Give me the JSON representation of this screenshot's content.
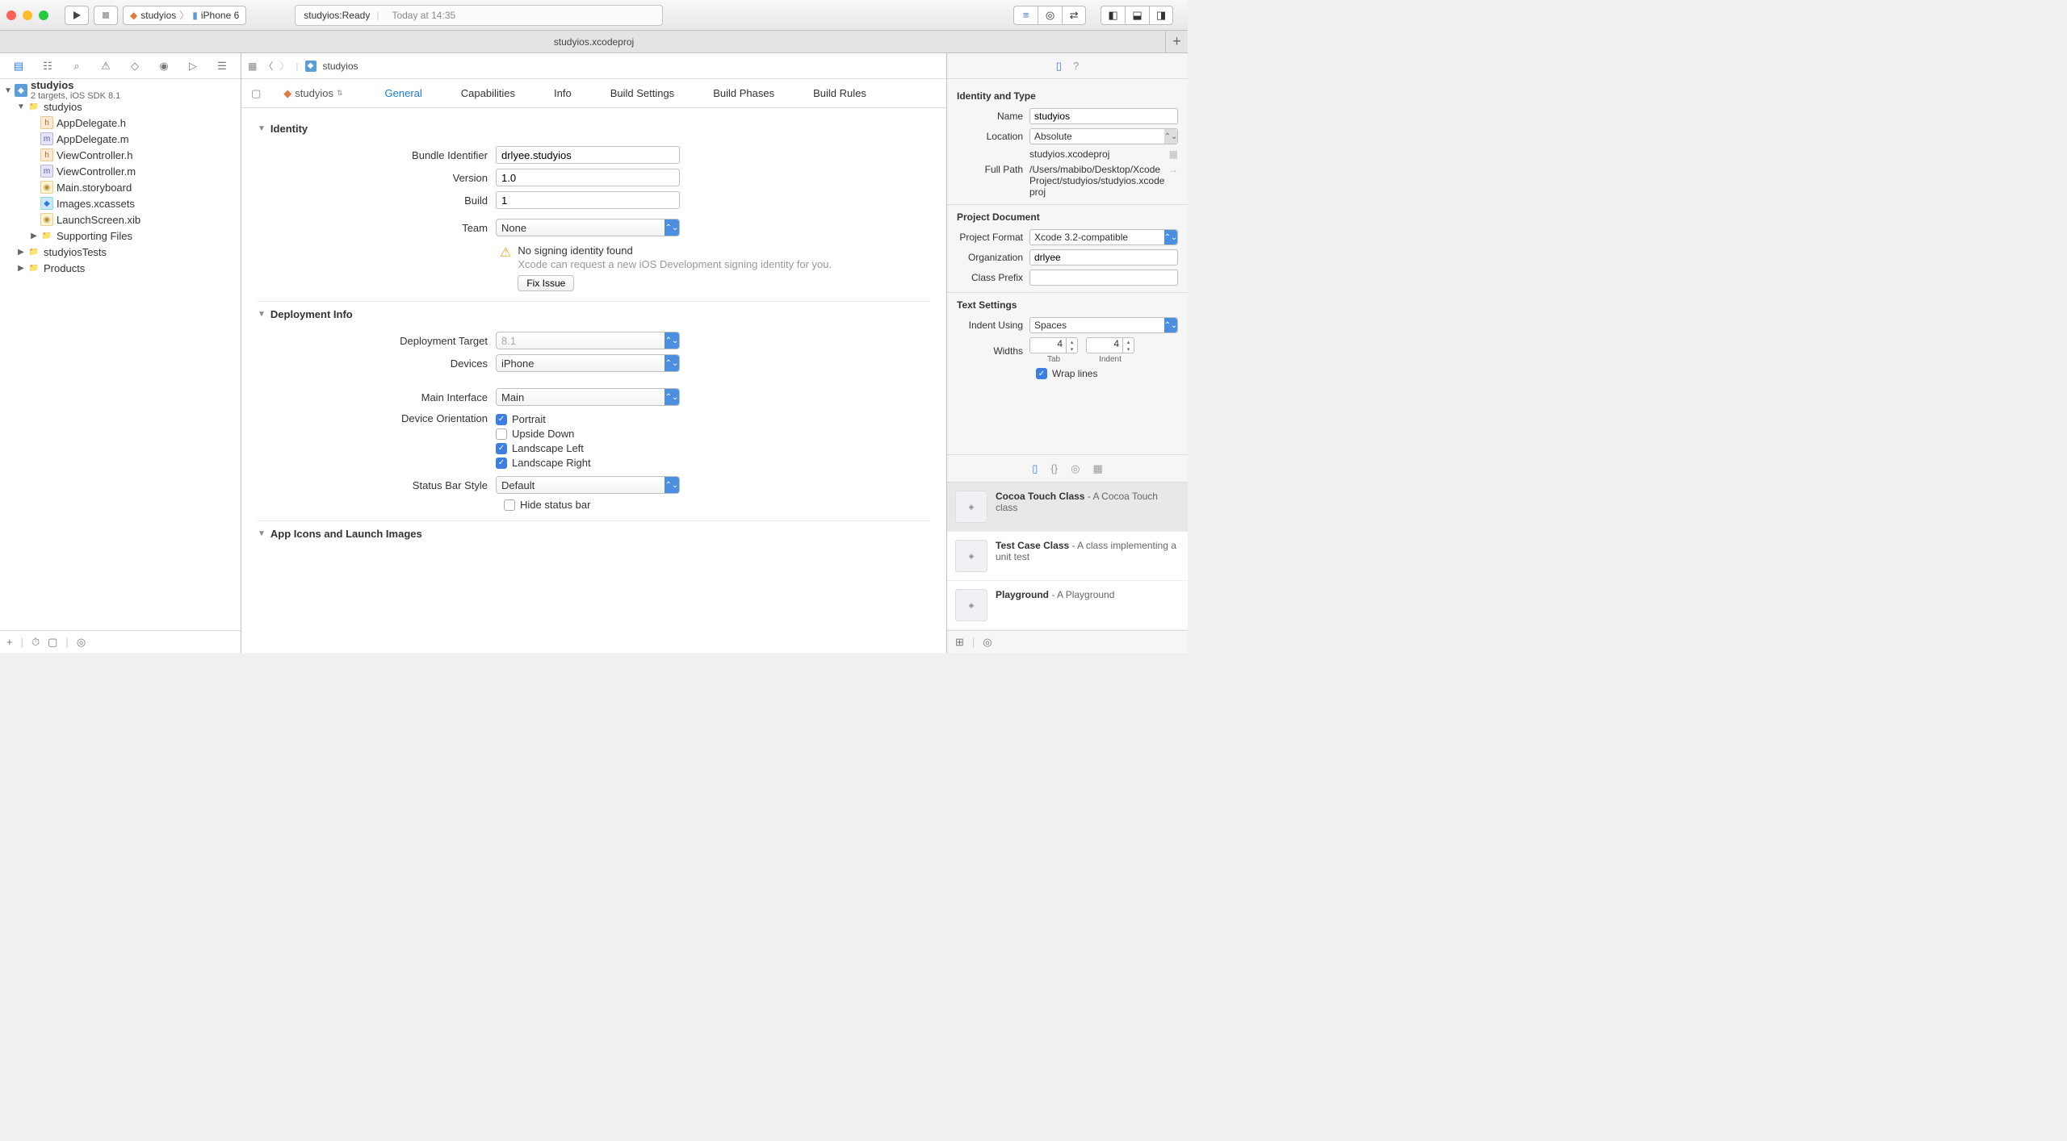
{
  "toolbar": {
    "scheme_project": "studyios",
    "scheme_device": "iPhone 6",
    "status_prefix": "studyios: ",
    "status_state": "Ready",
    "status_time": "Today at 14:35"
  },
  "tabbar": {
    "title": "studyios.xcodeproj"
  },
  "navigator": {
    "project_name": "studyios",
    "project_sub": "2 targets, iOS SDK 8.1",
    "groups": [
      {
        "name": "studyios",
        "kind": "folder",
        "expanded": true,
        "indent": 1,
        "children": [
          {
            "name": "AppDelegate.h",
            "kind": "h"
          },
          {
            "name": "AppDelegate.m",
            "kind": "m"
          },
          {
            "name": "ViewController.h",
            "kind": "h"
          },
          {
            "name": "ViewController.m",
            "kind": "m"
          },
          {
            "name": "Main.storyboard",
            "kind": "sb"
          },
          {
            "name": "Images.xcassets",
            "kind": "xc"
          },
          {
            "name": "LaunchScreen.xib",
            "kind": "sb"
          },
          {
            "name": "Supporting Files",
            "kind": "folder",
            "expanded": false
          }
        ]
      },
      {
        "name": "studyiosTests",
        "kind": "folder",
        "expanded": false,
        "indent": 1
      },
      {
        "name": "Products",
        "kind": "folder",
        "expanded": false,
        "indent": 1
      }
    ]
  },
  "jumpbar": {
    "item": "studyios"
  },
  "project_tabs": {
    "target_name": "studyios",
    "tabs": [
      "General",
      "Capabilities",
      "Info",
      "Build Settings",
      "Build Phases",
      "Build Rules"
    ],
    "active": 0
  },
  "identity": {
    "header": "Identity",
    "bundle_id_label": "Bundle Identifier",
    "bundle_id": "drlyee.studyios",
    "version_label": "Version",
    "version": "1.0",
    "build_label": "Build",
    "build": "1",
    "team_label": "Team",
    "team": "None",
    "warning_title": "No signing identity found",
    "warning_desc": "Xcode can request a new iOS Development signing identity for you.",
    "fix_label": "Fix Issue"
  },
  "deployment": {
    "header": "Deployment Info",
    "target_label": "Deployment Target",
    "target": "8.1",
    "devices_label": "Devices",
    "devices": "iPhone",
    "main_interface_label": "Main Interface",
    "main_interface": "Main",
    "orientation_label": "Device Orientation",
    "orientations": [
      {
        "label": "Portrait",
        "checked": true
      },
      {
        "label": "Upside Down",
        "checked": false
      },
      {
        "label": "Landscape Left",
        "checked": true
      },
      {
        "label": "Landscape Right",
        "checked": true
      }
    ],
    "statusbar_label": "Status Bar Style",
    "statusbar_style": "Default",
    "hide_statusbar_label": "Hide status bar",
    "hide_statusbar": false
  },
  "appicons": {
    "header": "App Icons and Launch Images"
  },
  "inspector": {
    "identity_header": "Identity and Type",
    "name_label": "Name",
    "name": "studyios",
    "location_label": "Location",
    "location": "Absolute",
    "location_path": "studyios.xcodeproj",
    "fullpath_label": "Full Path",
    "fullpath": "/Users/mabibo/Desktop/XcodeProject/studyios/studyios.xcodeproj",
    "projdoc_header": "Project Document",
    "format_label": "Project Format",
    "format": "Xcode 3.2-compatible",
    "org_label": "Organization",
    "org": "drlyee",
    "prefix_label": "Class Prefix",
    "prefix": "",
    "textset_header": "Text Settings",
    "indent_using_label": "Indent Using",
    "indent_using": "Spaces",
    "widths_label": "Widths",
    "tab_width": "4",
    "indent_width": "4",
    "tab_sublabel": "Tab",
    "indent_sublabel": "Indent",
    "wrap_label": "Wrap lines",
    "wrap": true
  },
  "library": [
    {
      "title": "Cocoa Touch Class",
      "desc": " - A Cocoa Touch class"
    },
    {
      "title": "Test Case Class",
      "desc": " - A class implementing a unit test"
    },
    {
      "title": "Playground",
      "desc": " - A Playground"
    }
  ]
}
